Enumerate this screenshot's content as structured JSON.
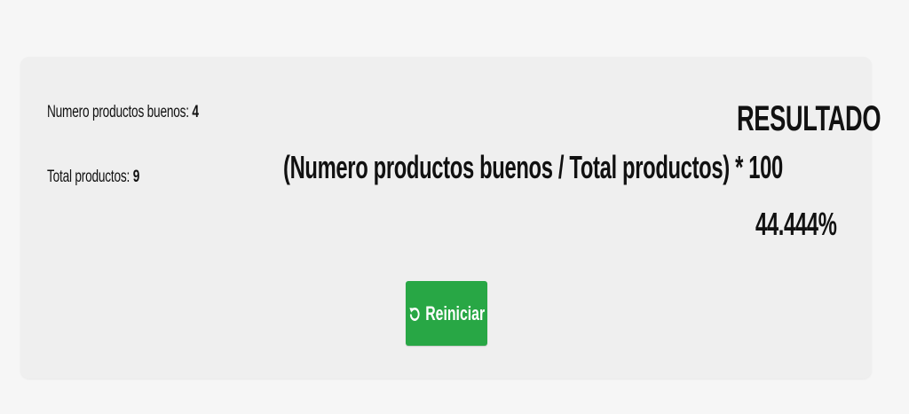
{
  "stats": {
    "good_label": "Numero productos buenos:",
    "good_value": "4",
    "total_label": "Total productos:",
    "total_value": "9"
  },
  "formula": "(Numero productos buenos / Total productos) * 100",
  "result": {
    "title": "RESULTADO",
    "value": "44.444%"
  },
  "reset_button": {
    "label": "Reiniciar",
    "icon": "rotate-left-icon",
    "color": "#28a745"
  }
}
